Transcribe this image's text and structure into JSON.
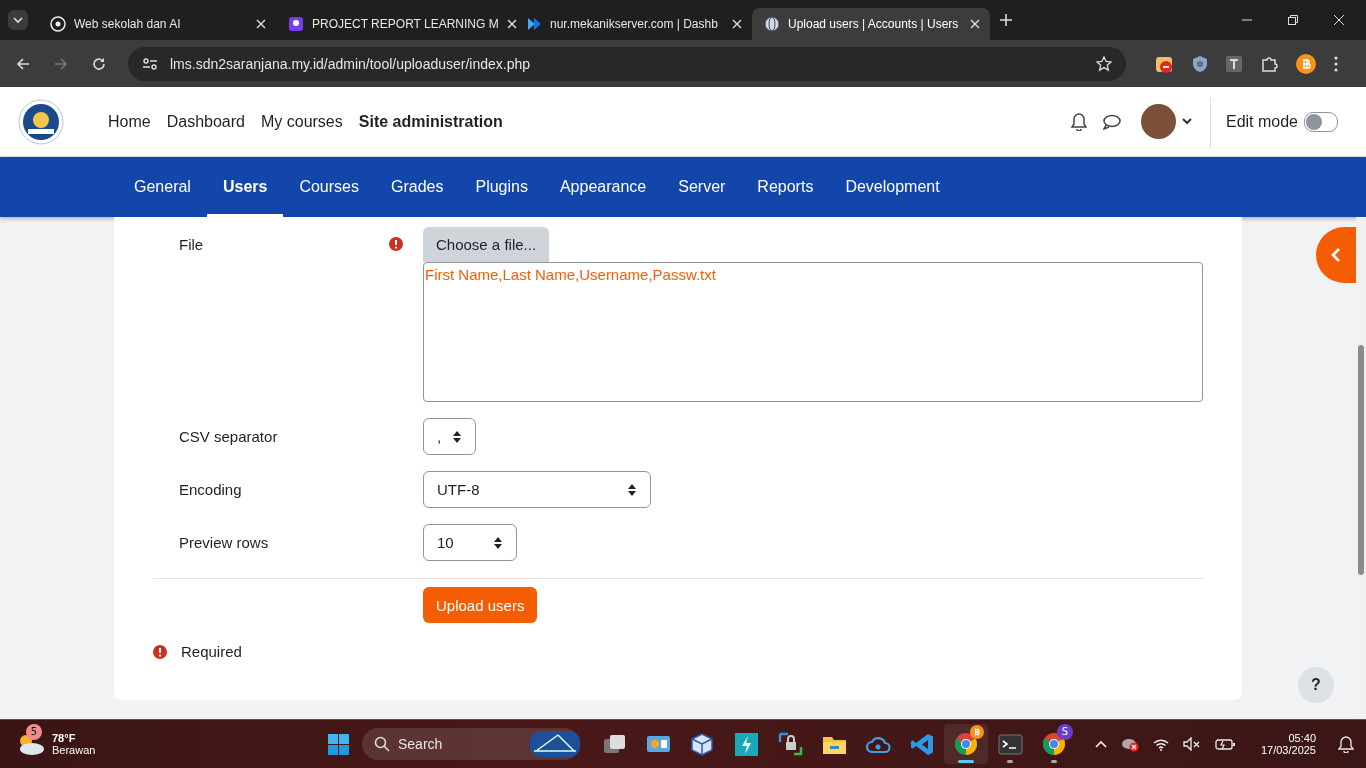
{
  "browser": {
    "tabs": [
      {
        "title": "Web sekolah dan AI",
        "selected": false
      },
      {
        "title": "PROJECT REPORT LEARNING M",
        "selected": false
      },
      {
        "title": "nur.mekanikserver.com | Dashb",
        "selected": false
      },
      {
        "title": "Upload users | Accounts | Users",
        "selected": true
      }
    ],
    "address": "lms.sdn2saranjana.my.id/admin/tool/uploaduser/index.php"
  },
  "header": {
    "nav_links": [
      {
        "label": "Home",
        "selected": false
      },
      {
        "label": "Dashboard",
        "selected": false
      },
      {
        "label": "My courses",
        "selected": false
      },
      {
        "label": "Site administration",
        "selected": true
      }
    ],
    "edit_mode": {
      "label": "Edit mode",
      "on": false
    }
  },
  "admin_tabs": [
    {
      "label": "General",
      "selected": false
    },
    {
      "label": "Users",
      "selected": true
    },
    {
      "label": "Courses",
      "selected": false
    },
    {
      "label": "Grades",
      "selected": false
    },
    {
      "label": "Plugins",
      "selected": false
    },
    {
      "label": "Appearance",
      "selected": false
    },
    {
      "label": "Server",
      "selected": false
    },
    {
      "label": "Reports",
      "selected": false
    },
    {
      "label": "Development",
      "selected": false
    }
  ],
  "form": {
    "file": {
      "label": "File",
      "required": true,
      "button": "Choose a file...",
      "filename": "First Name,Last Name,Username,Passw.txt"
    },
    "fields": [
      {
        "label": "CSV separator",
        "value": ","
      },
      {
        "label": "Encoding",
        "value": "UTF-8"
      },
      {
        "label": "Preview rows",
        "value": "10"
      }
    ],
    "submit": "Upload users",
    "required_note": "Required"
  },
  "help_button": "?",
  "taskbar": {
    "weather": {
      "badge": "5",
      "temperature": "78°F",
      "condition": "Berawan"
    },
    "search": {
      "label": "Search"
    },
    "apps": [
      {
        "kind": "windows",
        "running": false,
        "selected": false
      },
      {
        "kind": "taskview",
        "running": false,
        "selected": false
      },
      {
        "kind": "monitor",
        "running": false,
        "selected": false
      },
      {
        "kind": "box",
        "running": false,
        "selected": false
      },
      {
        "kind": "bolt",
        "running": false,
        "selected": false
      },
      {
        "kind": "lock",
        "running": false,
        "selected": false
      },
      {
        "kind": "folder",
        "running": false,
        "selected": false
      },
      {
        "kind": "cloud",
        "running": false,
        "selected": false
      },
      {
        "kind": "code",
        "running": false,
        "selected": false
      },
      {
        "kind": "walletbrowser",
        "running": true,
        "selected": true
      },
      {
        "kind": "terminal",
        "running": true,
        "selected": false
      },
      {
        "kind": "chrome",
        "running": true,
        "selected": false,
        "badge": "S"
      }
    ],
    "time": "05:40",
    "date": "17/03/2025"
  }
}
